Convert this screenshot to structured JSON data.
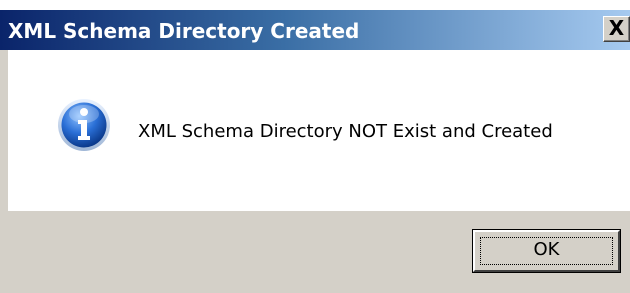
{
  "dialog": {
    "title": "XML Schema Directory Created",
    "close_label": "X",
    "message": "XML Schema Directory NOT Exist and Created",
    "icon": "info-icon",
    "ok_label": "OK"
  },
  "colors": {
    "title_gradient_start": "#0a246a",
    "title_gradient_end": "#a6caf0",
    "footer": "#d4d0c8",
    "icon_blue": "#1e5bb8"
  }
}
